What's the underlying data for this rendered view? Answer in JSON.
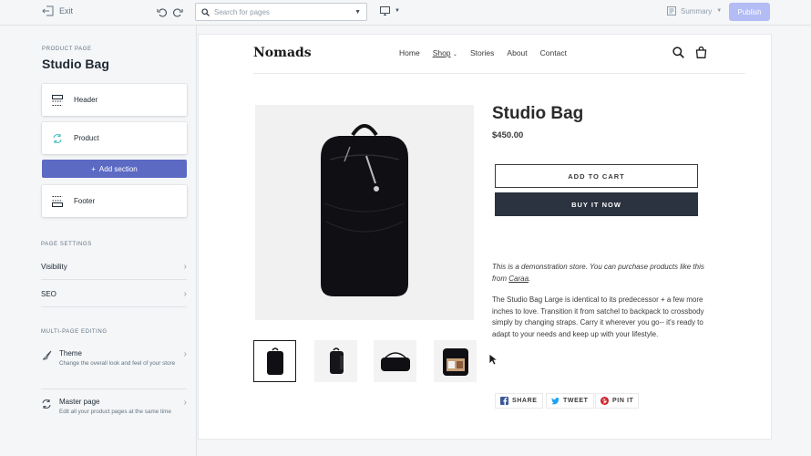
{
  "topbar": {
    "exit_label": "Exit",
    "search_placeholder": "Search for pages",
    "summary_label": "Summary",
    "publish_label": "Publish"
  },
  "sidebar": {
    "kicker": "PRODUCT PAGE",
    "title": "Studio Bag",
    "sections": [
      {
        "label": "Header",
        "icon": "header-section-icon"
      },
      {
        "label": "Product",
        "icon": "product-section-icon"
      }
    ],
    "add_section_label": "Add section",
    "footer_label": "Footer",
    "page_settings_heading": "PAGE SETTINGS",
    "settings": [
      {
        "label": "Visibility"
      },
      {
        "label": "SEO"
      }
    ],
    "multi_page_heading": "MULTI-PAGE EDITING",
    "multi_page": [
      {
        "title": "Theme",
        "subtitle": "Change the overall look and feel of your store",
        "icon": "theme-brush-icon"
      },
      {
        "title": "Master page",
        "subtitle": "Edit all your product pages at the same time",
        "icon": "master-page-sync-icon"
      }
    ]
  },
  "store": {
    "logo": "Nomads",
    "nav": [
      "Home",
      "Shop",
      "Stories",
      "About",
      "Contact"
    ],
    "active_nav": "Shop",
    "product_title": "Studio Bag",
    "price": "$450.00",
    "add_to_cart": "ADD TO CART",
    "buy_now": "BUY IT NOW",
    "demo_text": "This is a demonstration store. You can purchase products like this from ",
    "demo_link": "Caraa",
    "demo_end": ".",
    "description": "The Studio Bag Large is identical to its predecessor + a few more inches to love. Transition it from satchel to backpack to crossbody simply by changing straps. Carry it wherever you go-- it's ready to adapt to your needs and keep up with your lifestyle.",
    "share": {
      "share": "SHARE",
      "tweet": "TWEET",
      "pin": "PIN IT"
    }
  },
  "colors": {
    "accent": "#5c6ac4",
    "publish_disabled": "#b3bcf5",
    "buy_button": "#2b3240",
    "facebook": "#3b5998",
    "twitter": "#1da1f2",
    "pinterest": "#cb2027"
  }
}
